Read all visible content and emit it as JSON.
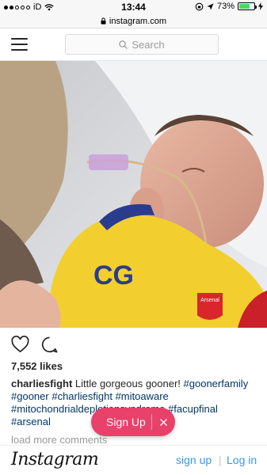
{
  "status_bar": {
    "carrier": "iD",
    "time": "13:44",
    "battery": "73%",
    "battery_level": 0.73,
    "wifi_icon": "wifi-icon",
    "signal_icon": "signal-dots-icon"
  },
  "browser": {
    "url": "instagram.com",
    "lock_icon": "lock-icon"
  },
  "header": {
    "menu_icon": "hamburger-icon",
    "search_placeholder": "Search"
  },
  "post": {
    "like_icon": "heart-icon",
    "comment_icon": "comment-icon",
    "likes": "7,552 likes",
    "username": "charliesfight",
    "caption_text": "Little gorgeous gooner!",
    "hashtags": [
      "#goonerfamily",
      "#gooner",
      "#charliesfight",
      "#mitoaware",
      "#mitochondrialdepletionsyndrome",
      "#facupfinal",
      "#arsenal"
    ],
    "load_more": "load more comments",
    "shirt_initials": "CG",
    "badge_text": "Arsenal"
  },
  "overlay": {
    "sign_up_label": "Sign Up",
    "close_icon": "close-icon",
    "color": "#e8416a"
  },
  "footer": {
    "logo": "Instagram",
    "sign_up": "sign up",
    "separator": "|",
    "log_in": "Log in",
    "link_color": "#3897f0"
  }
}
